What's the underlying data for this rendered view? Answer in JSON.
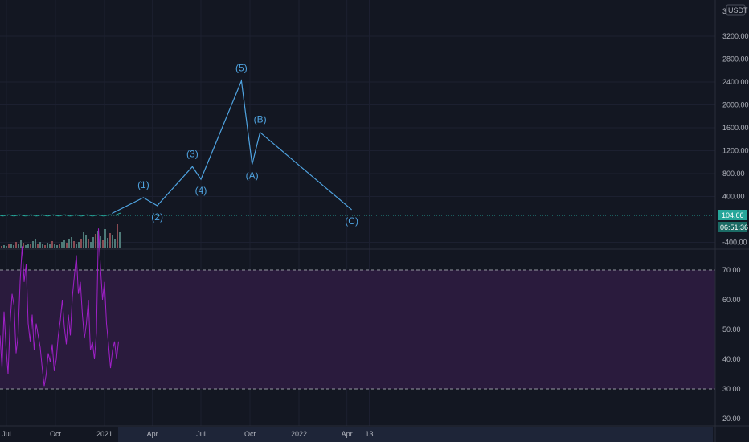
{
  "currency": "USDT",
  "scale_marker": "3",
  "price_badge": {
    "value": "104.66",
    "time": "06:51:36",
    "color": "#26a69a"
  },
  "colors": {
    "background": "#131722",
    "wave": "#4fa3e0",
    "rsi": "#a020c8",
    "rsi_band": "#2a1b3d",
    "price_line": "#26a69a",
    "volume_up": "#4e7a78",
    "volume_down": "#8a4a52"
  },
  "chart_data": [
    {
      "type": "line",
      "title": "",
      "description_of_axes": "price panel",
      "y_ticks": [
        "3200.00",
        "2800.00",
        "2400.00",
        "2000.00",
        "1600.00",
        "1200.00",
        "800.00",
        "400.00",
        "-400.00"
      ],
      "ylim": [
        -400,
        3400
      ],
      "x_ticks": [
        "Jul",
        "Oct",
        "2021",
        "Apr",
        "Jul",
        "Oct",
        "2022",
        "Apr",
        "13"
      ],
      "series": [
        {
          "kind": "elliott-wave",
          "points": [
            {
              "date": "2021-01-15",
              "y": 104.66,
              "label": ""
            },
            {
              "date": "2021-03-15",
              "y": 380,
              "label": "(1)"
            },
            {
              "date": "2021-04-10",
              "y": 240,
              "label": "(2)"
            },
            {
              "date": "2021-06-15",
              "y": 920,
              "label": "(3)"
            },
            {
              "date": "2021-07-01",
              "y": 700,
              "label": "(4)"
            },
            {
              "date": "2021-09-15",
              "y": 2420,
              "label": "(5)"
            },
            {
              "date": "2021-10-05",
              "y": 960,
              "label": "(A)"
            },
            {
              "date": "2021-10-20",
              "y": 1520,
              "label": "(B)"
            },
            {
              "date": "2022-04-10",
              "y": 170,
              "label": "(C)"
            }
          ]
        }
      ]
    },
    {
      "type": "line",
      "title": "",
      "y_ticks": [
        "70.00",
        "60.00",
        "50.00",
        "40.00",
        "30.00",
        "20.00"
      ],
      "ylim": [
        18,
        75
      ],
      "bands": [
        30,
        70
      ],
      "series": [
        {
          "kind": "rsi",
          "values": [
            48,
            37,
            56,
            44,
            35,
            52,
            62,
            58,
            42,
            48,
            66,
            78,
            66,
            72,
            52,
            46,
            55,
            43,
            52,
            48,
            44,
            37,
            31,
            35,
            42,
            39,
            45,
            36,
            40,
            48,
            53,
            60,
            51,
            45,
            55,
            48,
            61,
            68,
            75,
            62,
            66,
            55,
            47,
            52,
            60,
            43,
            46,
            40,
            49,
            84,
            71,
            60,
            66,
            52,
            45,
            37,
            43,
            46,
            40,
            46
          ]
        }
      ]
    }
  ]
}
